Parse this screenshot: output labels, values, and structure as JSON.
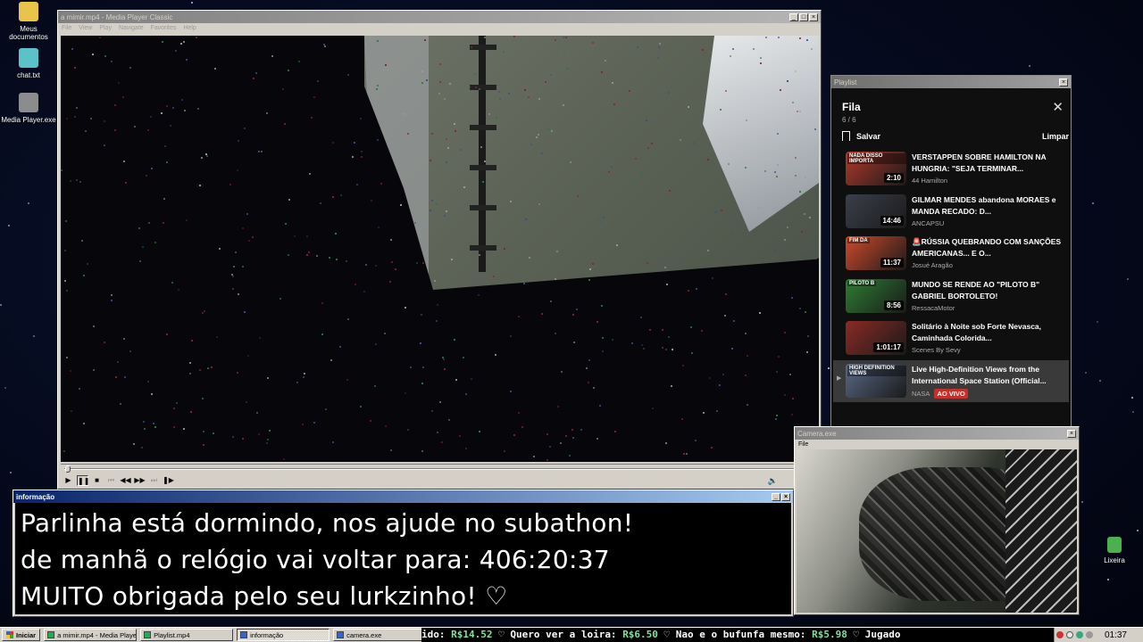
{
  "desktop": {
    "icons": [
      {
        "label": "Meus documentos",
        "icon": "folder-icon"
      },
      {
        "label": "chat.txt",
        "icon": "text-file-icon"
      },
      {
        "label": "Media Player.exe",
        "icon": "app-icon"
      },
      {
        "label": "Lixeira",
        "icon": "recycle-bin-icon"
      }
    ]
  },
  "mpc": {
    "title": "a mimir.mp4 - Media Player Classic",
    "menu": [
      "File",
      "View",
      "Play",
      "Navigate",
      "Favorites",
      "Help"
    ],
    "controls": [
      "play",
      "pause",
      "stop",
      "prev",
      "rewind",
      "forward",
      "next",
      "frame-step"
    ],
    "volume_icon": "speaker-icon"
  },
  "playlist_window": {
    "title": "Playlist",
    "heading": "Fila",
    "count": "6 / 6",
    "save_label": "Salvar",
    "clear_label": "Limpar",
    "items": [
      {
        "title": "VERSTAPPEN SOBRE HAMILTON NA HUNGRIA: \"SEJA TERMINAR...",
        "channel": "44 Hamilton",
        "duration": "2:10",
        "thumb_label": "NADA DISSO IMPORTA",
        "thumb_color": "#b0382c"
      },
      {
        "title": "GILMAR MENDES abandona MORAES e MANDA RECADO: D...",
        "channel": "ANCAPSU",
        "duration": "14:46",
        "thumb_label": "",
        "thumb_color": "#3b3f4a"
      },
      {
        "title": "🚨RÚSSIA QUEBRANDO COM SANÇÕES AMERICANAS... E O...",
        "channel": "Josué Aragão",
        "duration": "11:37",
        "thumb_label": "FIM DA",
        "thumb_color": "#d04a2a"
      },
      {
        "title": "MUNDO SE RENDE AO \"PILOTO B\" GABRIEL BORTOLETO!",
        "channel": "RessacaMotor",
        "duration": "8:56",
        "thumb_label": "PILOTO B",
        "thumb_color": "#2e7d32"
      },
      {
        "title": "Solitário à Noite sob Forte Nevasca, Caminhada Colorida...",
        "channel": "Scenes By Sevy",
        "duration": "1:01:17",
        "thumb_label": "",
        "thumb_color": "#8a2a24"
      },
      {
        "title": "Live High-Definition Views from the International Space Station (Official...",
        "channel": "NASA",
        "duration": "",
        "live_label": "AO VIVO",
        "thumb_label": "HIGH DEFINITION VIEWS",
        "thumb_color": "#5a6a88",
        "current": true
      }
    ]
  },
  "camera": {
    "title": "Camera.exe",
    "menu": [
      "File"
    ]
  },
  "info_window": {
    "title": "informação",
    "lines": [
      "Parlinha está dormindo, nos ajude no subathon!",
      "de manhã o relógio vai voltar para:  406:20:37",
      "MUITO obrigada pelo seu lurkzinho! ♡"
    ]
  },
  "taskbar": {
    "start_label": "Iniciar",
    "tasks": [
      {
        "label": "a mimir.mp4 - Media Playe...",
        "active": false
      },
      {
        "label": "Playlist.mp4",
        "active": false
      },
      {
        "label": "informação",
        "active": true
      },
      {
        "label": "camera.exe",
        "active": false
      }
    ],
    "ticker": [
      {
        "text": "ido: ",
        "money": "R$14.52"
      },
      {
        "text": "  ♡  Quero ver a loira: ",
        "money": "R$6.50"
      },
      {
        "text": "  ♡  Nao e o bufunfa mesmo: ",
        "money": "R$5.98"
      },
      {
        "text": "  ♡  Jugado",
        "money": ""
      }
    ],
    "clock": "01:37"
  },
  "colors": {
    "youtube_live": "#c4302b",
    "title_active": "#0a246a",
    "desktop_bg": "#05091c"
  }
}
